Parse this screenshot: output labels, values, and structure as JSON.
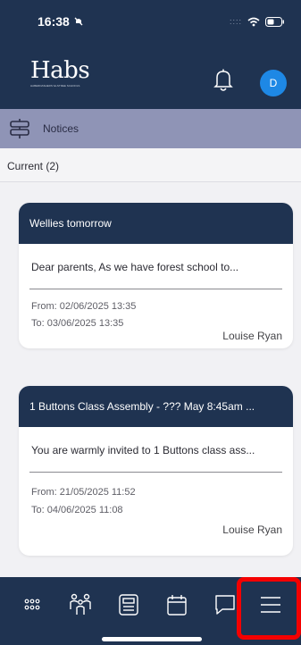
{
  "status_bar": {
    "time": "16:38"
  },
  "header": {
    "logo_text": "Habs",
    "logo_subtext": "HABERDASHERS' ELSTREE SCHOOLS",
    "avatar_initial": "D"
  },
  "notices_bar": {
    "title": "Notices"
  },
  "section": {
    "label": "Current (2)"
  },
  "notices": [
    {
      "title": "Wellies tomorrow",
      "preview": "Dear parents,   As we have forest school to...",
      "from": "From: 02/06/2025 13:35",
      "to": "To: 03/06/2025 13:35",
      "author": "Louise Ryan"
    },
    {
      "title": "1 Buttons Class Assembly - ??? May 8:45am ...",
      "preview": "You are warmly invited to 1 Buttons class ass...",
      "from": "From: 21/05/2025 11:52",
      "to": "To: 04/06/2025 11:08",
      "author": "Louise Ryan"
    }
  ],
  "bottom_nav": {
    "items": [
      "apps-grid-icon",
      "family-icon",
      "newspaper-icon",
      "calendar-icon",
      "chat-icon",
      "menu-icon"
    ]
  },
  "colors": {
    "navy": "#1f3351",
    "accent_purple": "#8f94b6",
    "avatar_blue": "#1e88e5",
    "highlight_red": "#f40000"
  }
}
